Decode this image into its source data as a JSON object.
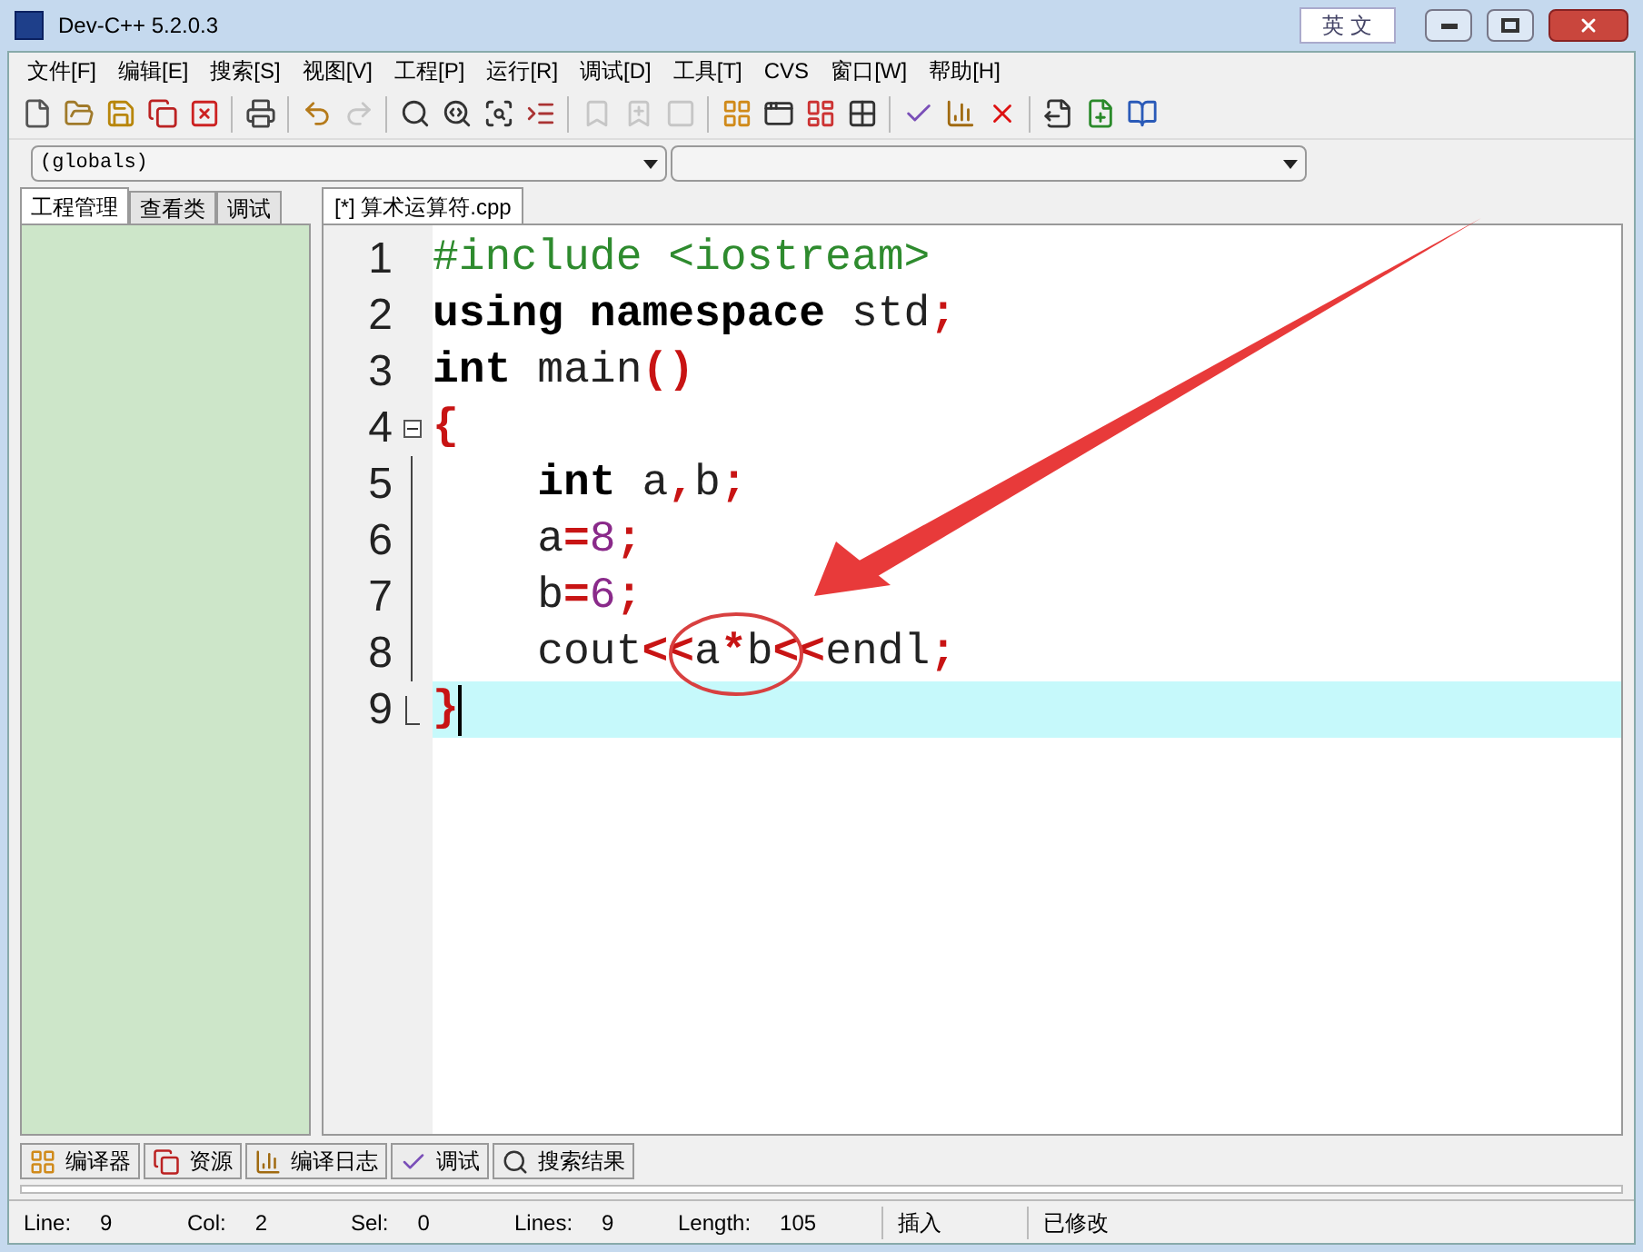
{
  "window": {
    "title": "Dev-C++ 5.2.0.3",
    "ime": "英 文"
  },
  "menu": [
    "文件[F]",
    "编辑[E]",
    "搜索[S]",
    "视图[V]",
    "工程[P]",
    "运行[R]",
    "调试[D]",
    "工具[T]",
    "CVS",
    "窗口[W]",
    "帮助[H]"
  ],
  "toolbar": [
    {
      "kind": "new",
      "disabled": false
    },
    {
      "kind": "open",
      "disabled": false
    },
    {
      "kind": "save",
      "disabled": false
    },
    {
      "kind": "saveall",
      "disabled": false
    },
    {
      "kind": "close",
      "disabled": false
    },
    {
      "kind": "sep"
    },
    {
      "kind": "print",
      "disabled": false
    },
    {
      "kind": "sep"
    },
    {
      "kind": "undo",
      "disabled": false
    },
    {
      "kind": "redo",
      "disabled": true
    },
    {
      "kind": "sep"
    },
    {
      "kind": "find",
      "disabled": false
    },
    {
      "kind": "replace",
      "disabled": false
    },
    {
      "kind": "findnext",
      "disabled": false
    },
    {
      "kind": "goto",
      "disabled": false
    },
    {
      "kind": "sep"
    },
    {
      "kind": "bookmark",
      "disabled": true
    },
    {
      "kind": "bookmark2",
      "disabled": true
    },
    {
      "kind": "stop",
      "disabled": true
    },
    {
      "kind": "sep"
    },
    {
      "kind": "compile",
      "disabled": false
    },
    {
      "kind": "run",
      "disabled": false
    },
    {
      "kind": "compilerun",
      "disabled": false
    },
    {
      "kind": "rebuild",
      "disabled": false
    },
    {
      "kind": "sep"
    },
    {
      "kind": "check",
      "disabled": false
    },
    {
      "kind": "chart",
      "disabled": false
    },
    {
      "kind": "delete",
      "disabled": false
    },
    {
      "kind": "sep"
    },
    {
      "kind": "projectopen",
      "disabled": false
    },
    {
      "kind": "projectadd",
      "disabled": false
    },
    {
      "kind": "book",
      "disabled": false
    }
  ],
  "combos": [
    {
      "value": "(globals)"
    }
  ],
  "left_tabs": [
    {
      "label": "工程管理",
      "selected": true
    },
    {
      "label": "查看类",
      "selected": false
    },
    {
      "label": "调试",
      "selected": false
    }
  ],
  "editor_tabs": [
    {
      "label": "[*] 算术运算符.cpp",
      "selected": true
    }
  ],
  "code": [
    {
      "number": "1",
      "kind": "plain",
      "current": false,
      "tokens": [
        {
          "kind": "pre",
          "text": "#include <iostream>"
        }
      ]
    },
    {
      "number": "2",
      "kind": "plain",
      "current": false,
      "tokens": [
        {
          "kind": "kw",
          "text": "using namespace"
        },
        {
          "kind": "id",
          "text": " std"
        },
        {
          "kind": "op",
          "text": ";"
        }
      ]
    },
    {
      "number": "3",
      "kind": "plain",
      "current": false,
      "tokens": [
        {
          "kind": "kw",
          "text": "int"
        },
        {
          "kind": "id",
          "text": " main"
        },
        {
          "kind": "op",
          "text": "()"
        }
      ]
    },
    {
      "number": "4",
      "kind": "start",
      "current": false,
      "tokens": [
        {
          "kind": "op",
          "text": "{"
        }
      ]
    },
    {
      "number": "5",
      "kind": "body",
      "current": false,
      "tokens": [
        {
          "kind": "kw",
          "text": "    int"
        },
        {
          "kind": "id",
          "text": " a"
        },
        {
          "kind": "op",
          "text": ","
        },
        {
          "kind": "id",
          "text": "b"
        },
        {
          "kind": "op",
          "text": ";"
        }
      ]
    },
    {
      "number": "6",
      "kind": "body",
      "current": false,
      "tokens": [
        {
          "kind": "id",
          "text": "    a"
        },
        {
          "kind": "op",
          "text": "="
        },
        {
          "kind": "num",
          "text": "8"
        },
        {
          "kind": "op",
          "text": ";"
        }
      ]
    },
    {
      "number": "7",
      "kind": "body",
      "current": false,
      "tokens": [
        {
          "kind": "id",
          "text": "    b"
        },
        {
          "kind": "op",
          "text": "="
        },
        {
          "kind": "num",
          "text": "6"
        },
        {
          "kind": "op",
          "text": ";"
        }
      ]
    },
    {
      "number": "8",
      "kind": "body",
      "current": false,
      "tokens": [
        {
          "kind": "id",
          "text": "    cout"
        },
        {
          "kind": "op",
          "text": "<<"
        },
        {
          "kind": "id",
          "text": "a"
        },
        {
          "kind": "op",
          "text": "*"
        },
        {
          "kind": "id",
          "text": "b"
        },
        {
          "kind": "op",
          "text": "<<"
        },
        {
          "kind": "id",
          "text": "endl"
        },
        {
          "kind": "op",
          "text": ";"
        }
      ]
    },
    {
      "number": "9",
      "kind": "end",
      "current": true,
      "tokens": [
        {
          "kind": "op",
          "text": "}"
        }
      ]
    }
  ],
  "bottom_tabs": [
    {
      "kind": "compiler",
      "label": "编译器"
    },
    {
      "kind": "resources",
      "label": "资源"
    },
    {
      "kind": "log",
      "label": "编译日志"
    },
    {
      "kind": "debug",
      "label": "调试"
    },
    {
      "kind": "search",
      "label": "搜索结果"
    }
  ],
  "status_bar": [
    {
      "label": "Line:",
      "value": "9"
    },
    {
      "label": "Col:",
      "value": "2"
    },
    {
      "label": "Sel:",
      "value": "0"
    },
    {
      "label": "Lines:",
      "value": "9"
    },
    {
      "label": "Length:",
      "value": "105"
    },
    {
      "value": "插入"
    },
    {
      "value": "已修改"
    }
  ]
}
